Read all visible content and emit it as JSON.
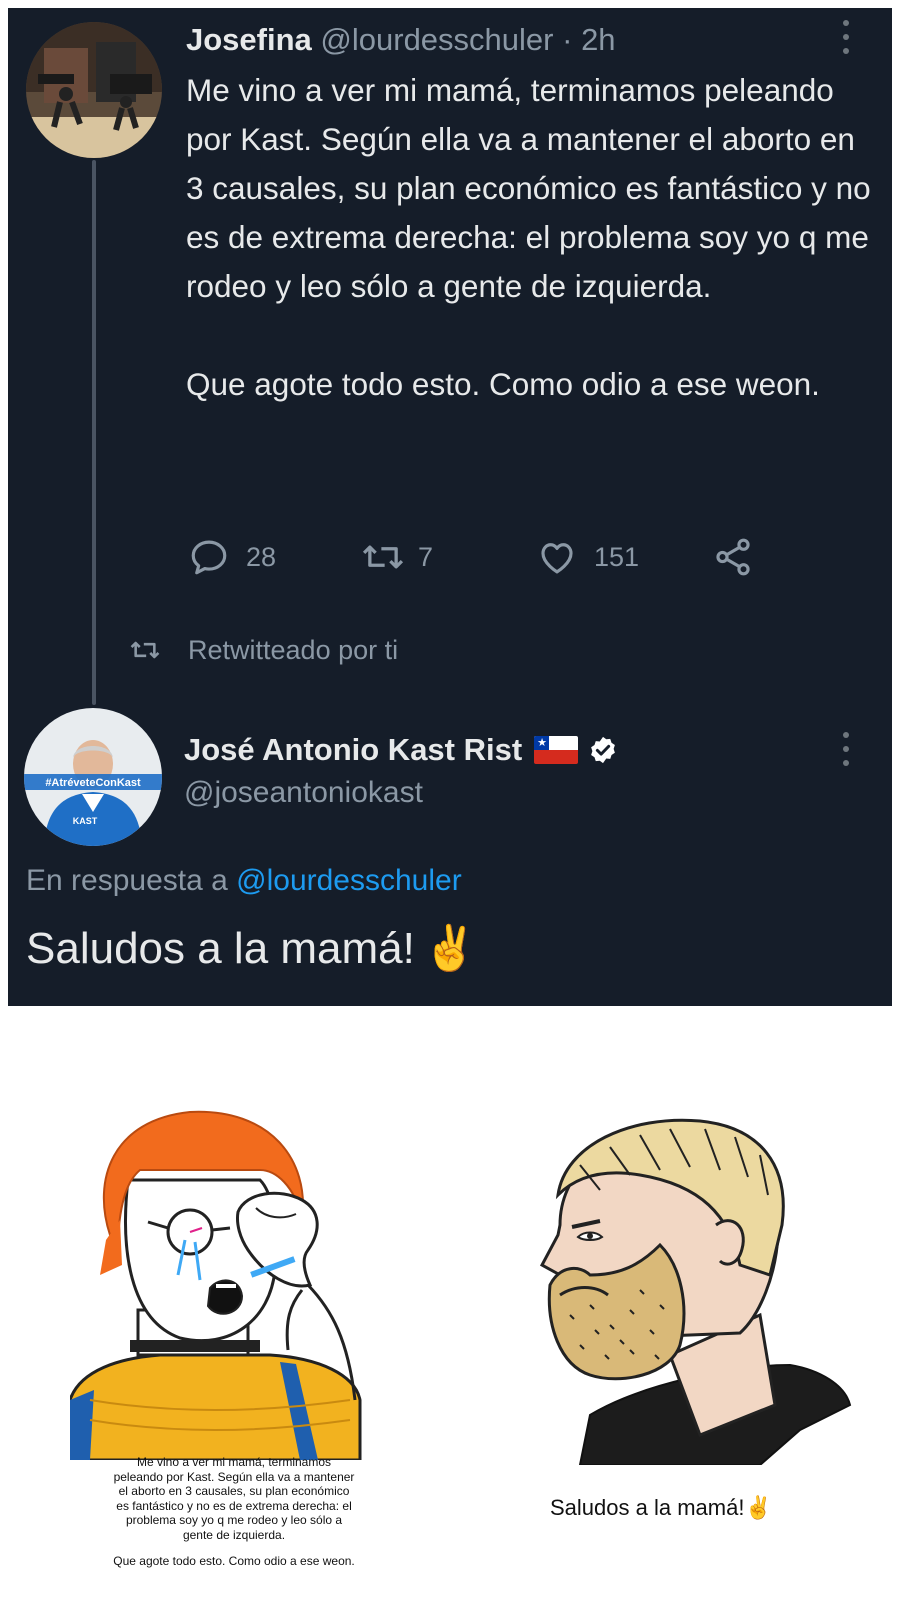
{
  "tweet1": {
    "name": "Josefina",
    "handle": "@lourdesschuler",
    "dot": "·",
    "time": "2h",
    "text_p1": "Me vino a ver mi mamá, terminamos peleando por Kast. Según ella va a mantener el aborto en 3 causales, su plan económico es fantástico y no es de extrema derecha: el problema soy yo q me rodeo y leo sólo a gente de izquierda.",
    "text_p2": "Que agote todo esto. Como odio a ese weon.",
    "actions": {
      "replies": "28",
      "retweets": "7",
      "likes": "151"
    },
    "avatar_icon": "avatar-photo-icon",
    "more_icon": "more-vertical-icon"
  },
  "retweet_notice": {
    "label": "Retwitteado por ti",
    "icon": "retweet-icon"
  },
  "tweet2": {
    "name": "José Antonio Kast Rist",
    "flag_icon": "chile-flag-icon",
    "verified_icon": "verified-badge-icon",
    "handle": "@joseantoniokast",
    "reply_prefix": "En respuesta a",
    "reply_mention": "@lourdesschuler",
    "text": "Saludos a la mamá!",
    "emoji": "✌️",
    "avatar_icon": "avatar-photo-icon",
    "avatar_text_banner": "#AtréveteConKast",
    "avatar_text_logo": "KAST"
  },
  "meme": {
    "left_caption_p1": "Me vino a ver mi mamá, terminamos peleando por Kast. Según ella va a mantener el aborto en 3 causales, su plan económico es fantástico y no es de extrema derecha: el problema soy yo q me rodeo y leo sólo a gente de izquierda.",
    "left_caption_p2": "Que agote todo esto. Como odio a ese weon.",
    "right_caption": "Saludos a la mamá!",
    "right_emoji": "✌️",
    "left_figure": "crying-wojak-illustration",
    "right_figure": "bearded-chad-illustration"
  },
  "colors": {
    "background_dark": "#151d29",
    "text_primary": "#e7e9ea",
    "text_secondary": "#8b98a5",
    "link": "#1d9bf0"
  }
}
